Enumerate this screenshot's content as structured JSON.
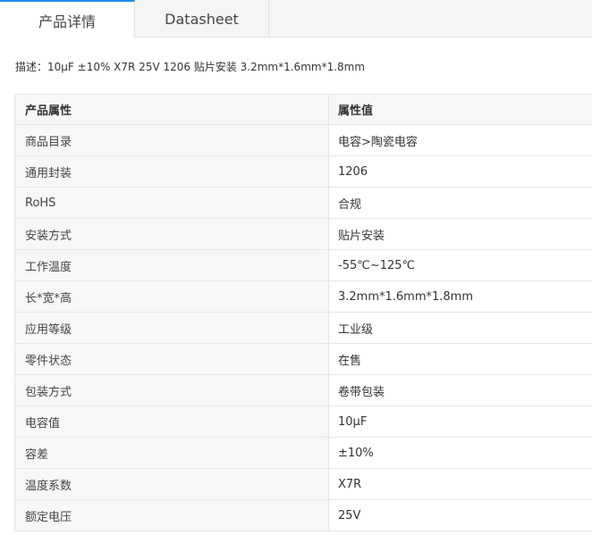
{
  "tabs": [
    {
      "label": "产品详情",
      "active": true
    },
    {
      "label": "Datasheet",
      "active": false
    }
  ],
  "accent_color": "#1f8ce6",
  "description": {
    "label": "描述：",
    "text": "10μF ±10% X7R 25V 1206 贴片安装 3.2mm*1.6mm*1.8mm"
  },
  "table": {
    "header": {
      "key": "产品属性",
      "value": "属性值"
    },
    "rows": [
      {
        "key": "商品目录",
        "value": "电容>陶瓷电容"
      },
      {
        "key": "通用封装",
        "value": "1206"
      },
      {
        "key": "RoHS",
        "value": "合规"
      },
      {
        "key": "安装方式",
        "value": "贴片安装"
      },
      {
        "key": "工作温度",
        "value": "-55℃~125℃"
      },
      {
        "key": "长*宽*高",
        "value": "3.2mm*1.6mm*1.8mm"
      },
      {
        "key": "应用等级",
        "value": "工业级"
      },
      {
        "key": "零件状态",
        "value": "在售"
      },
      {
        "key": "包装方式",
        "value": "卷带包装"
      },
      {
        "key": "电容值",
        "value": "10μF"
      },
      {
        "key": "容差",
        "value": "±10%"
      },
      {
        "key": "温度系数",
        "value": "X7R"
      },
      {
        "key": "额定电压",
        "value": "25V"
      }
    ]
  }
}
